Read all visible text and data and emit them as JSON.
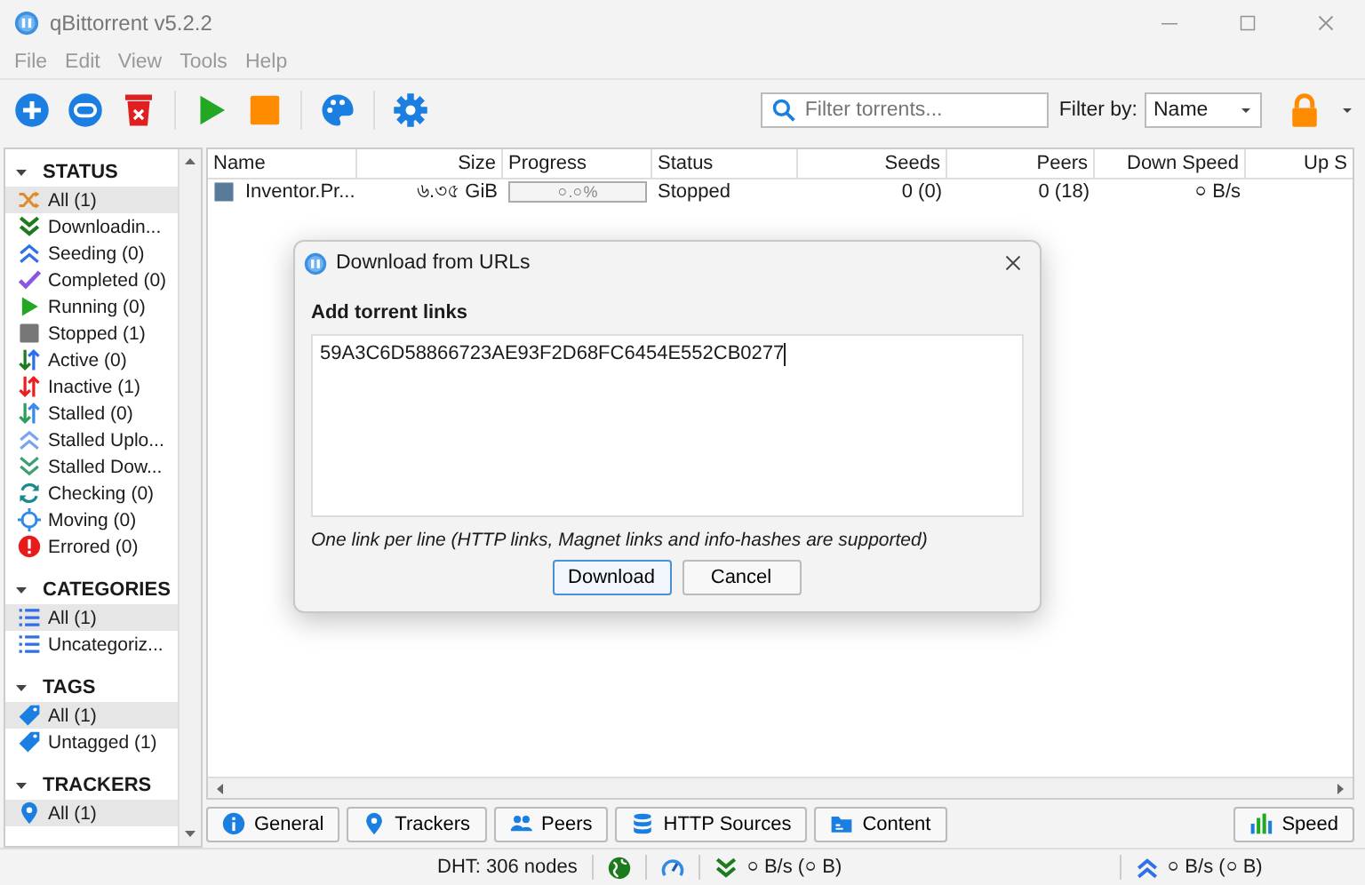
{
  "window": {
    "title": "qBittorrent v5.2.2"
  },
  "menu": [
    "File",
    "Edit",
    "View",
    "Tools",
    "Help"
  ],
  "search": {
    "placeholder": "Filter torrents..."
  },
  "filter": {
    "label": "Filter by:",
    "value": "Name"
  },
  "sidebar": {
    "sections": [
      {
        "title": "STATUS",
        "expanded": true,
        "items": [
          {
            "label": "All (1)",
            "selected": true
          },
          {
            "label": "Downloadin...",
            "selected": false
          },
          {
            "label": "Seeding (0)",
            "selected": false
          },
          {
            "label": "Completed (0)",
            "selected": false
          },
          {
            "label": "Running (0)",
            "selected": false
          },
          {
            "label": "Stopped (1)",
            "selected": false
          },
          {
            "label": "Active (0)",
            "selected": false
          },
          {
            "label": "Inactive (1)",
            "selected": false
          },
          {
            "label": "Stalled (0)",
            "selected": false
          },
          {
            "label": "Stalled Uplo...",
            "selected": false
          },
          {
            "label": "Stalled Dow...",
            "selected": false
          },
          {
            "label": "Checking (0)",
            "selected": false
          },
          {
            "label": "Moving (0)",
            "selected": false
          },
          {
            "label": "Errored (0)",
            "selected": false
          }
        ]
      },
      {
        "title": "CATEGORIES",
        "expanded": true,
        "items": [
          {
            "label": "All (1)",
            "selected": true
          },
          {
            "label": "Uncategoriz...",
            "selected": false
          }
        ]
      },
      {
        "title": "TAGS",
        "expanded": true,
        "items": [
          {
            "label": "All (1)",
            "selected": true
          },
          {
            "label": "Untagged (1)",
            "selected": false
          }
        ]
      },
      {
        "title": "TRACKERS",
        "expanded": true,
        "items": [
          {
            "label": "All (1)",
            "selected": true
          }
        ]
      }
    ]
  },
  "table": {
    "columns": [
      "Name",
      "Size",
      "Progress",
      "Status",
      "Seeds",
      "Peers",
      "Down Speed",
      "Up S"
    ],
    "rows": [
      {
        "name": "Inventor.Pr...",
        "size": "৬.৩৫ GiB",
        "progress": {
          "level": 0,
          "text": "০.০%"
        },
        "status": "Stopped",
        "seeds": "0 (0)",
        "peers": "0 (18)",
        "down_speed": "০ B/s"
      }
    ]
  },
  "bottom_tabs": [
    "General",
    "Trackers",
    "Peers",
    "HTTP Sources",
    "Content"
  ],
  "speed_button": "Speed",
  "status_bar": {
    "dht": "DHT: 306 nodes",
    "download": "০ B/s (০ B)",
    "upload": "০ B/s (০ B)"
  },
  "dialog": {
    "title": "Download from URLs",
    "label": "Add torrent links",
    "value": "59A3C6D58866723AE93F2D68FC6454E552CB0277",
    "hint": "One link per line (HTTP links, Magnet links and info-hashes are supported)",
    "buttons": [
      {
        "label": "Download",
        "default": true
      },
      {
        "label": "Cancel",
        "default": false
      }
    ]
  }
}
